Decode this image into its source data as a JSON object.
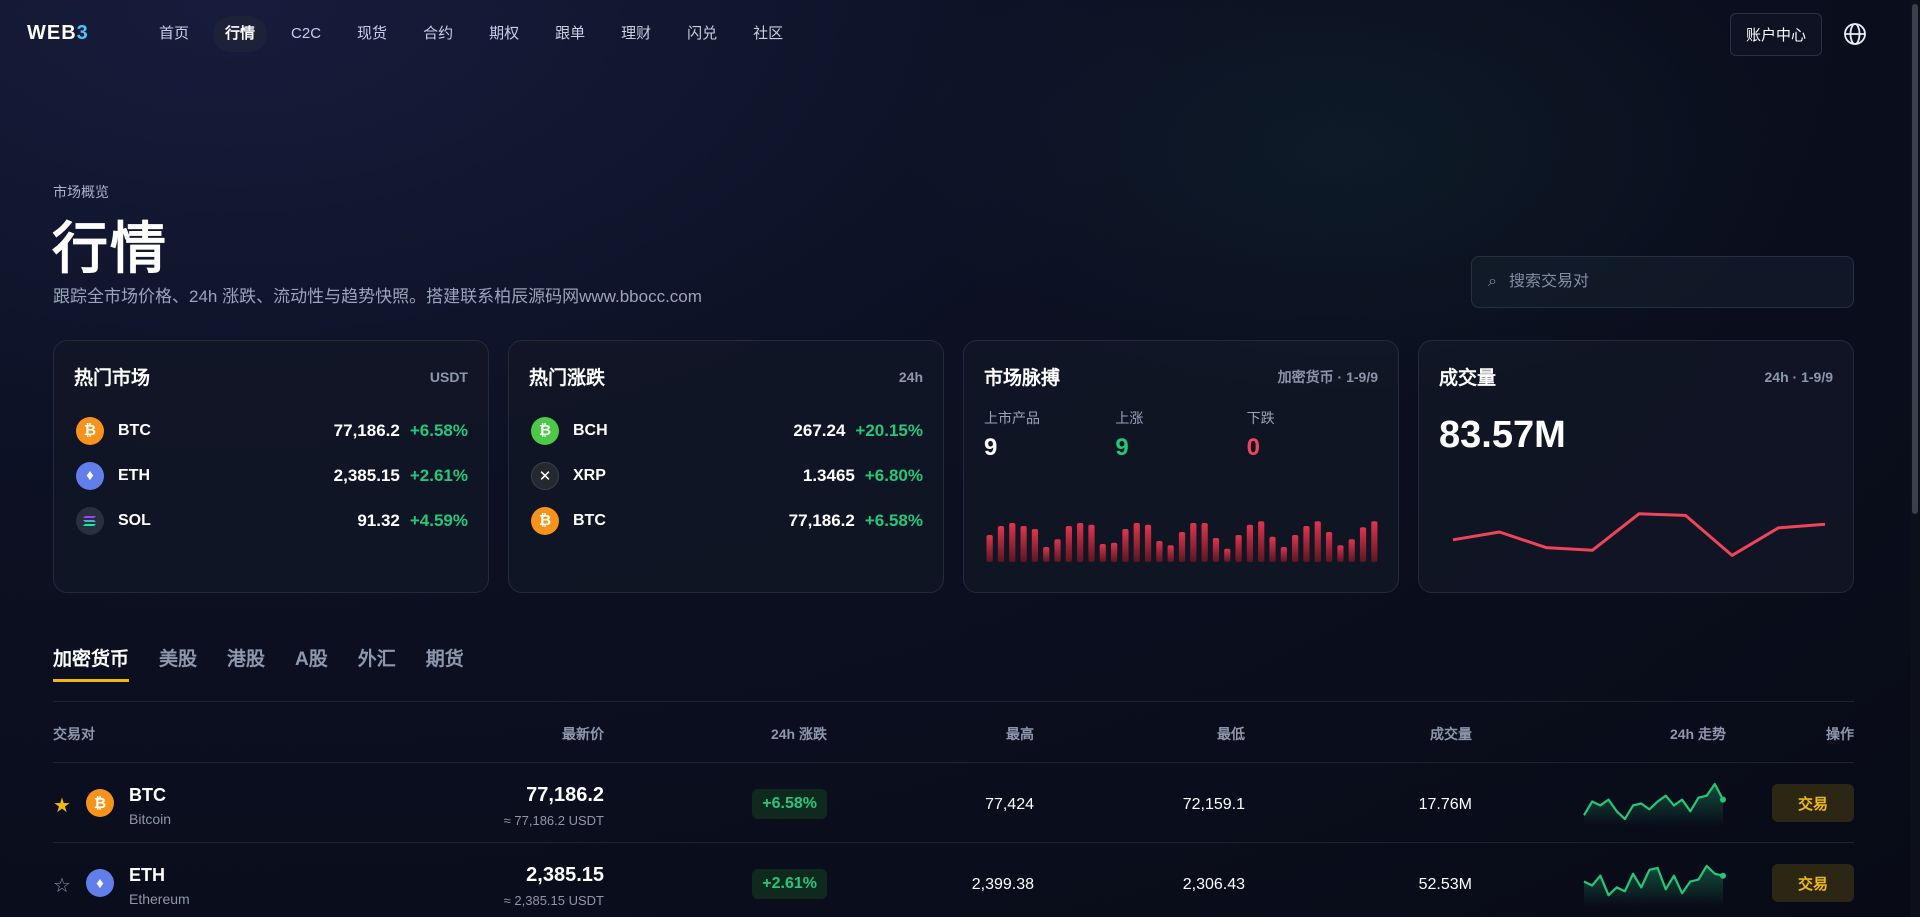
{
  "nav": {
    "logo_main": "WEB",
    "logo_accent": "3",
    "items": [
      "首页",
      "行情",
      "C2C",
      "现货",
      "合约",
      "期权",
      "跟单",
      "理财",
      "闪兑",
      "社区"
    ],
    "active_index": 1,
    "account_label": "账户中心",
    "globe_icon": "globe-icon"
  },
  "hero": {
    "eyebrow": "市场概览",
    "title": "行情",
    "description": "跟踪全市场价格、24h 涨跌、流动性与趋势快照。搭建联系柏辰源码网www.bbocc.com",
    "search_placeholder": "搜索交易对",
    "search_icon": "search-icon"
  },
  "cards": {
    "hot_market": {
      "title": "热门市场",
      "tag": "USDT",
      "rows": [
        {
          "symbol": "BTC",
          "price": "77,186.2",
          "change": "+6.58%",
          "icon": "bitcoin-icon"
        },
        {
          "symbol": "ETH",
          "price": "2,385.15",
          "change": "+2.61%",
          "icon": "ethereum-icon"
        },
        {
          "symbol": "SOL",
          "price": "91.32",
          "change": "+4.59%",
          "icon": "solana-icon"
        }
      ]
    },
    "hot_movers": {
      "title": "热门涨跌",
      "tag": "24h",
      "rows": [
        {
          "symbol": "BCH",
          "price": "267.24",
          "change": "+20.15%",
          "icon": "bitcoin-cash-icon"
        },
        {
          "symbol": "XRP",
          "price": "1.3465",
          "change": "+6.80%",
          "icon": "xrp-icon"
        },
        {
          "symbol": "BTC",
          "price": "77,186.2",
          "change": "+6.58%",
          "icon": "bitcoin-icon"
        }
      ]
    },
    "pulse": {
      "title": "市场脉搏",
      "tag": "加密货币 · 1-9/9",
      "stats": [
        {
          "label": "上市产品",
          "value": "9",
          "color": "#ffffff"
        },
        {
          "label": "上涨",
          "value": "9",
          "color": "#22c77a"
        },
        {
          "label": "下跌",
          "value": "0",
          "color": "#f0445a"
        }
      ],
      "bar_levels": [
        0.45,
        0.6,
        0.65,
        0.6,
        0.55,
        0.25,
        0.38,
        0.6,
        0.65,
        0.62,
        0.3,
        0.32,
        0.55,
        0.65,
        0.62,
        0.35,
        0.28,
        0.5,
        0.65,
        0.65,
        0.4,
        0.22,
        0.45,
        0.62,
        0.68,
        0.42,
        0.25,
        0.45,
        0.6,
        0.68,
        0.5,
        0.28,
        0.38,
        0.58,
        0.68
      ],
      "bar_color": "#e0354f"
    },
    "volume": {
      "title": "成交量",
      "tag": "24h · 1-9/9",
      "value": "83.57M",
      "trend": [
        0.35,
        0.5,
        0.2,
        0.15,
        0.85,
        0.82,
        0.05,
        0.58,
        0.65
      ],
      "line_color": "#f0445a"
    }
  },
  "tabs": {
    "items": [
      "加密货币",
      "美股",
      "港股",
      "A股",
      "外汇",
      "期货"
    ],
    "active_index": 0
  },
  "table": {
    "headers": {
      "pair": "交易对",
      "last": "最新价",
      "change": "24h 涨跌",
      "high": "最高",
      "low": "最低",
      "volume": "成交量",
      "trend": "24h 走势",
      "action": "操作"
    },
    "rows": [
      {
        "favorite": true,
        "symbol": "BTC",
        "name": "Bitcoin",
        "price": "77,186.2",
        "price_sub": "≈ 77,186.2 USDT",
        "change": "+6.58%",
        "high": "77,424",
        "low": "72,159.1",
        "volume": "17.76M",
        "action": "交易",
        "icon": "bitcoin-icon",
        "spark": [
          0.2,
          0.55,
          0.45,
          0.6,
          0.3,
          0.1,
          0.45,
          0.5,
          0.35,
          0.55,
          0.7,
          0.45,
          0.6,
          0.3,
          0.65,
          0.7,
          1.0,
          0.6
        ]
      },
      {
        "favorite": false,
        "symbol": "ETH",
        "name": "Ethereum",
        "price": "2,385.15",
        "price_sub": "≈ 2,385.15 USDT",
        "change": "+2.61%",
        "high": "2,399.38",
        "low": "2,306.43",
        "volume": "52.53M",
        "action": "交易",
        "icon": "ethereum-icon",
        "spark": [
          0.55,
          0.45,
          0.7,
          0.2,
          0.4,
          0.3,
          0.75,
          0.4,
          0.85,
          0.9,
          0.35,
          0.7,
          0.25,
          0.55,
          0.6,
          0.95,
          0.75,
          0.7
        ]
      }
    ],
    "spark_color": "#22c77a"
  }
}
